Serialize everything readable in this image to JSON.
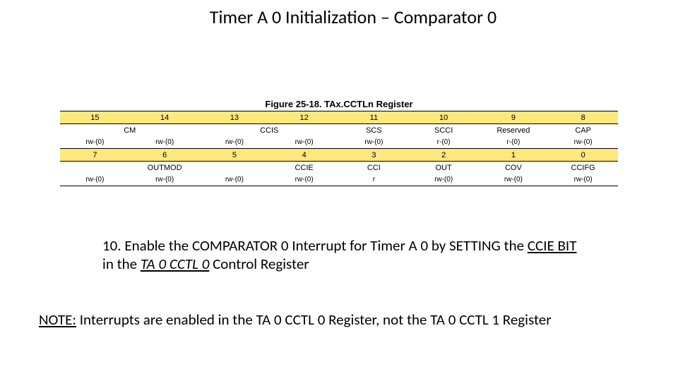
{
  "title": "Timer A 0 Initialization – Comparator 0",
  "figure": {
    "caption": "Figure 25-18. TAx.CCTLn Register",
    "rows": [
      {
        "bits": [
          "15",
          "14",
          "13",
          "12",
          "11",
          "10",
          "9",
          "8"
        ],
        "names": [
          "CM",
          "",
          "CCIS",
          "",
          "SCS",
          "SCCI",
          "Reserved",
          "CAP"
        ],
        "name_span": [
          2,
          0,
          2,
          0,
          1,
          1,
          1,
          1
        ],
        "rw": [
          "rw-(0)",
          "rw-(0)",
          "rw-(0)",
          "rw-(0)",
          "rw-(0)",
          "r-(0)",
          "r-(0)",
          "rw-(0)"
        ],
        "seps": [
          false,
          false,
          true,
          false,
          true,
          true,
          true,
          true
        ]
      },
      {
        "bits": [
          "7",
          "6",
          "5",
          "4",
          "3",
          "2",
          "1",
          "0"
        ],
        "names": [
          "OUTMOD",
          "",
          "",
          "CCIE",
          "CCI",
          "OUT",
          "COV",
          "CCIFG"
        ],
        "name_span": [
          3,
          0,
          0,
          1,
          1,
          1,
          1,
          1
        ],
        "rw": [
          "rw-(0)",
          "rw-(0)",
          "rw-(0)",
          "rw-(0)",
          "r",
          "rw-(0)",
          "rw-(0)",
          "rw-(0)"
        ],
        "seps": [
          false,
          false,
          false,
          true,
          true,
          true,
          true,
          true
        ]
      }
    ]
  },
  "step": {
    "num": "10.",
    "t1": "  Enable the COMPARATOR 0 Interrupt for Timer A 0 by SETTING the ",
    "bit": "CCIE BIT",
    "t2": " in the ",
    "reg": "TA 0 CCTL 0",
    "t3": "  Control Register"
  },
  "note": {
    "label": "NOTE:",
    "text": " Interrupts are enabled in the TA 0 CCTL 0 Register, not the TA 0 CCTL 1 Register"
  }
}
